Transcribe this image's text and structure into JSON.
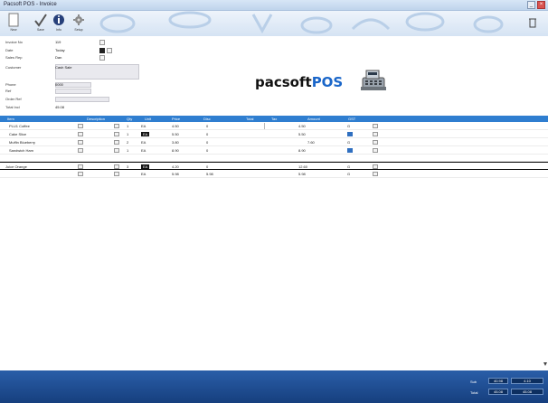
{
  "app": {
    "title": "Pacsoft POS - Invoice",
    "close_glyph": "×",
    "min_glyph": "_"
  },
  "toolbar": {
    "items": [
      {
        "label": "New",
        "icon": "page-icon"
      },
      {
        "label": "Save",
        "icon": "checkmark-icon"
      },
      {
        "label": "Info",
        "icon": "info-icon"
      },
      {
        "label": "Setup",
        "icon": "gear-icon"
      }
    ]
  },
  "form": {
    "rows": [
      {
        "label": "Invoice No",
        "value": "119"
      },
      {
        "label": "Date",
        "value": "Today"
      },
      {
        "label": "Sales Rep",
        "value": "Dan"
      },
      {
        "label": "Customer",
        "value": "Cash Sale"
      },
      {
        "label": "Phone",
        "value": "0000"
      },
      {
        "label": "Ref",
        "value": ""
      },
      {
        "label": "Order Ref",
        "value": ""
      },
      {
        "label": "Total Incl",
        "value": "45.08"
      }
    ]
  },
  "logo": {
    "text_main": "pacsoft",
    "text_pos": "POS"
  },
  "grid": {
    "headers": [
      {
        "text": "Item"
      },
      {
        "text": "Description"
      },
      {
        "text": "Qty"
      },
      {
        "text": "Unit"
      },
      {
        "text": "Price"
      },
      {
        "text": "Disc"
      },
      {
        "text": "Total"
      },
      {
        "text": "Tax"
      },
      {
        "text": "Amount"
      },
      {
        "text": "GST"
      }
    ],
    "rows": [
      {
        "code": "PLU1 Coffee",
        "qty": "1",
        "unit": "EA",
        "price": "4.50",
        "disc": "0",
        "total": "4.50",
        "amount": "4.50",
        "tax": "G"
      },
      {
        "code": "Cake Slice",
        "qty": "1",
        "unit": "EA",
        "price": "5.50",
        "disc": "0",
        "total": "5.50",
        "amount": "5.50",
        "tax": "G"
      },
      {
        "code": "Muffin Blueberry",
        "qty": "2",
        "unit": "EA",
        "price": "3.80",
        "disc": "0",
        "total": "7.60",
        "amount": "7.60",
        "tax": "G"
      },
      {
        "code": "Sandwich Ham",
        "qty": "1",
        "unit": "EA",
        "price": "8.90",
        "disc": "0",
        "total": "8.90",
        "amount": "8.90",
        "tax": "G"
      },
      {
        "code": "Juice Orange",
        "qty": "3",
        "unit": "EA",
        "price": "4.20",
        "disc": "0",
        "total": "12.60",
        "amount": "12.60",
        "tax": "G"
      },
      {
        "code": "",
        "qty": "",
        "unit": "EA",
        "price": "5.98",
        "disc": "",
        "total": "5.98",
        "amount": "5.98",
        "tax": "G"
      }
    ]
  },
  "status": {
    "label_a": "Sub",
    "value_a": "40.98",
    "label_b": "Total",
    "value_b": "45.08",
    "value_c": "4.10"
  }
}
